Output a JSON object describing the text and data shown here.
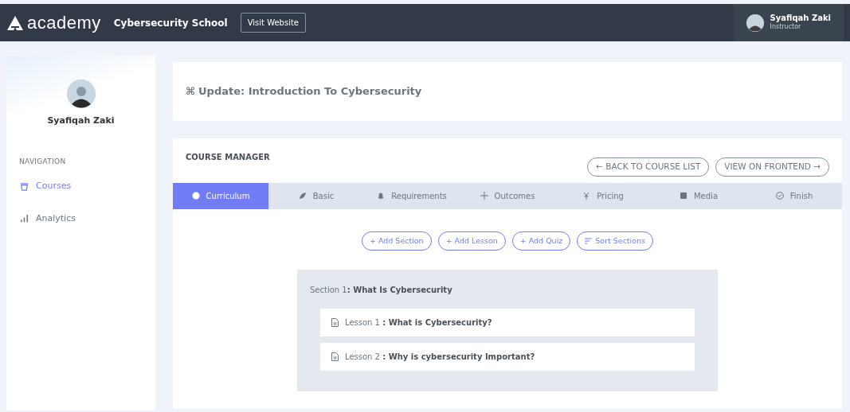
{
  "topbar": {
    "logo": "academy",
    "school": "Cybersecurity School",
    "visit_button": "Visit Website",
    "user": {
      "name": "Syafiqah Zaki",
      "role": "Instructor"
    }
  },
  "sidebar": {
    "user_name": "Syafiqah Zaki",
    "heading": "NAVIGATION",
    "items": [
      {
        "label": "Courses",
        "selected": true
      },
      {
        "label": "Analytics",
        "selected": false
      }
    ]
  },
  "page_title": {
    "glyph": "⌘",
    "text": "Update: Introduction To Cybersecurity"
  },
  "course_manager": {
    "title": "COURSE MANAGER",
    "actions": [
      "← BACK TO COURSE LIST",
      "VIEW ON FRONTEND →"
    ],
    "tabs": [
      {
        "label": "Curriculum",
        "selected": true
      },
      {
        "label": "Basic",
        "selected": false
      },
      {
        "label": "Requirements",
        "selected": false
      },
      {
        "label": "Outcomes",
        "selected": false
      },
      {
        "label": "Pricing",
        "selected": false
      },
      {
        "label": "Media",
        "selected": false
      },
      {
        "label": "Finish",
        "selected": false
      }
    ],
    "tools": [
      {
        "label": "+ Add Section",
        "kind": "plain"
      },
      {
        "label": "+ Add Lesson",
        "kind": "plain"
      },
      {
        "label": "+ Add Quiz",
        "kind": "plain"
      },
      {
        "label": "Sort Sections",
        "kind": "sort"
      }
    ],
    "sections": [
      {
        "title": "Section 1**: What Is Cybersecurity**",
        "lessons": [
          {
            "title": "Lesson 1 **: What is Cybersecurity?**"
          },
          {
            "title": "Lesson 2 **: Why is cybersecurity Important?**"
          }
        ]
      }
    ]
  }
}
